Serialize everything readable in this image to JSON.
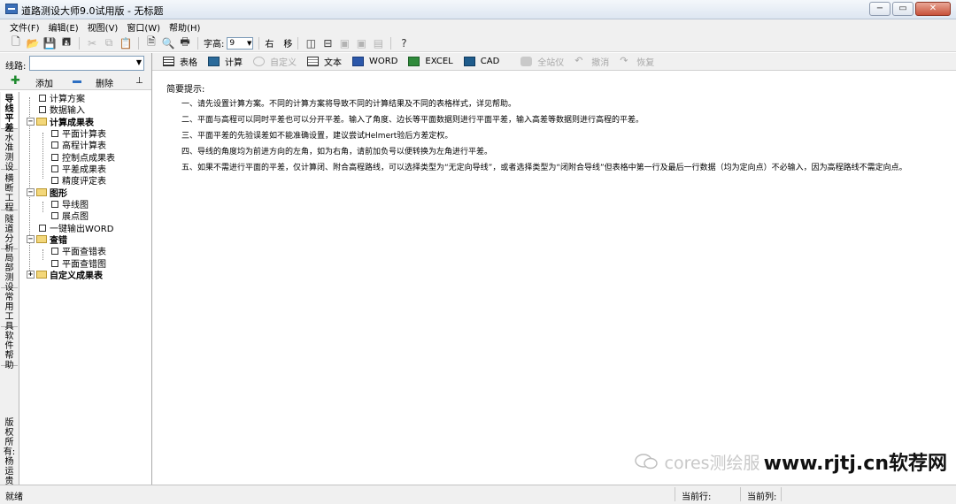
{
  "window": {
    "title": "道路测设大师9.0试用版 - 无标题",
    "controls": {
      "minimize": "−",
      "restore": "▭",
      "close": "✕"
    }
  },
  "menu": [
    "文件(F)",
    "编辑(E)",
    "视图(V)",
    "窗口(W)",
    "帮助(H)"
  ],
  "toolbar1": {
    "font_height_label": "字高:",
    "font_height_value": "9",
    "btn_right": "右",
    "btn_move": "移"
  },
  "toolbar2": [
    {
      "label": "表格",
      "icon": "table-icon",
      "enabled": true
    },
    {
      "label": "计算",
      "icon": "calc-icon",
      "enabled": true
    },
    {
      "label": "自定义",
      "icon": "custom-icon",
      "enabled": false
    },
    {
      "label": "文本",
      "icon": "text-icon",
      "enabled": true
    },
    {
      "label": "WORD",
      "icon": "word-icon",
      "enabled": true
    },
    {
      "label": "EXCEL",
      "icon": "excel-icon",
      "enabled": true
    },
    {
      "label": "CAD",
      "icon": "cad-icon",
      "enabled": true
    },
    {
      "label": "全站仪",
      "icon": "total-station-icon",
      "enabled": false
    },
    {
      "label": "撤消",
      "icon": "undo-icon",
      "enabled": false
    },
    {
      "label": "恢复",
      "icon": "redo-icon",
      "enabled": false
    }
  ],
  "left": {
    "route_label": "线路:",
    "route_value": "",
    "add_label": "添加",
    "delete_label": "删除",
    "pin_glyph": "⊥"
  },
  "vtabs": [
    "导线平差",
    "水准测设",
    "横断工程",
    "隧道分析",
    "局部测设",
    "常用工具",
    "软件帮助",
    "版权所有:杨运贵"
  ],
  "tree": {
    "calc_plan": "计算方案",
    "data_input": "数据输入",
    "calc_results": "计算成果表",
    "plane_calc": "平面计算表",
    "elev_calc": "高程计算表",
    "control_results": "控制点成果表",
    "adjust_results": "平差成果表",
    "precision_eval": "精度评定表",
    "graphics": "图形",
    "traverse_chart": "导线图",
    "point_chart": "展点图",
    "export_word": "一键输出WORD",
    "error_check": "查错",
    "plane_error_table": "平面查错表",
    "plane_error_chart": "平面查错图",
    "custom_results": "自定义成果表"
  },
  "hints": {
    "title": "简要提示:",
    "lines": [
      "一、请先设置计算方案。不同的计算方案将导致不同的计算结果及不同的表格样式，详见帮助。",
      "二、平面与高程可以同时平差也可以分开平差。输入了角度、边长等平面数据则进行平面平差，输入高差等数据则进行高程的平差。",
      "三、平面平差的先验误差如不能准确设置，建议尝试Helmert验后方差定权。",
      "四、导线的角度均为前进方向的左角，如为右角，请前加负号以便转换为左角进行平差。",
      "五、如果不需进行平面的平差，仅计算闭、附合高程路线，可以选择类型为“无定向导线”，或者选择类型为“闭附合导线”但表格中第一行及最后一行数据（均为定向点）不必输入，因为高程路线不需定向点。"
    ]
  },
  "watermark": {
    "faded": "cores测绘服",
    "strong": "www.rjtj.cn软荐网"
  },
  "status": {
    "ready": "就绪",
    "current_row": "当前行:",
    "current_col": "当前列:"
  }
}
